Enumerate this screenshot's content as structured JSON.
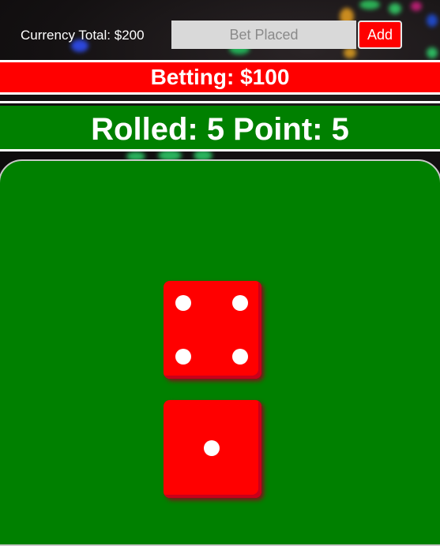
{
  "header": {
    "currency_label": "Currency Total: $200",
    "bet_placeholder": "Bet Placed",
    "add_label": "Add"
  },
  "betting": {
    "text": "Betting: $100"
  },
  "roll": {
    "text": "Rolled: 5 Point: 5"
  },
  "dice": [
    {
      "name": "die-top",
      "value": 4,
      "icon": "die-four-icon"
    },
    {
      "name": "die-bottom",
      "value": 1,
      "icon": "die-one-icon"
    }
  ],
  "colors": {
    "accent_red": "#ff0000",
    "table_green": "#008000",
    "pip": "#ffffff"
  }
}
